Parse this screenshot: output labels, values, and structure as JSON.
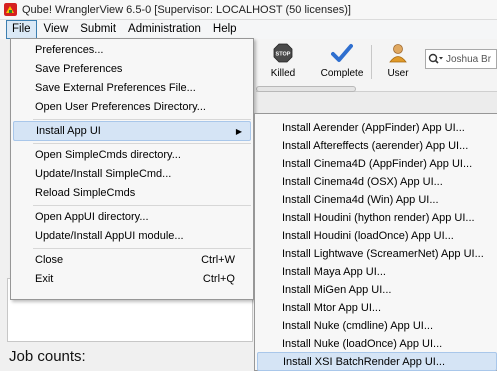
{
  "window": {
    "title": "Qube! WranglerView 6.5-0 [Supervisor: LOCALHOST (50 licenses)]"
  },
  "menubar": {
    "items": [
      {
        "label": "File",
        "active": true
      },
      {
        "label": "View",
        "active": false
      },
      {
        "label": "Submit",
        "active": false
      },
      {
        "label": "Administration",
        "active": false
      },
      {
        "label": "Help",
        "active": false
      }
    ]
  },
  "toolbar": {
    "stop_badge": "STOP",
    "killed_label": "Killed",
    "complete_label": "Complete",
    "user_label": "User",
    "search_value": "Joshua Br"
  },
  "file_menu": {
    "items": [
      {
        "label": "Preferences..."
      },
      {
        "label": "Save Preferences"
      },
      {
        "label": "Save External Preferences File..."
      },
      {
        "label": "Open User Preferences Directory..."
      },
      {
        "label": "Install App UI",
        "has_submenu": true,
        "highlighted": true
      },
      {
        "label": "Open SimpleCmds directory..."
      },
      {
        "label": "Update/Install SimpleCmd..."
      },
      {
        "label": "Reload SimpleCmds"
      },
      {
        "label": "Open AppUI directory..."
      },
      {
        "label": "Update/Install AppUI module..."
      },
      {
        "label": "Close",
        "shortcut": "Ctrl+W"
      },
      {
        "label": "Exit",
        "shortcut": "Ctrl+Q"
      }
    ]
  },
  "install_submenu": {
    "items": [
      "Install Aerender (AppFinder) App UI...",
      "Install Aftereffects (aerender) App UI...",
      "Install Cinema4D (AppFinder) App UI...",
      "Install Cinema4d (OSX) App UI...",
      "Install Cinema4d (Win) App UI...",
      "Install Houdini (hython render) App UI...",
      "Install Houdini (loadOnce) App UI...",
      "Install Lightwave (ScreamerNet) App UI...",
      "Install Maya App UI...",
      "Install MiGen App UI...",
      "Install Mtor App UI...",
      "Install Nuke (cmdline) App UI...",
      "Install Nuke (loadOnce) App UI...",
      "Install XSI BatchRender App UI..."
    ],
    "highlighted_index": 13
  },
  "main": {
    "job_counts_label": "Job counts:"
  },
  "colors": {
    "highlight": "#d5e4f5",
    "highlight_border": "#a9c7ea",
    "menu_active": "#3c7fb1"
  }
}
